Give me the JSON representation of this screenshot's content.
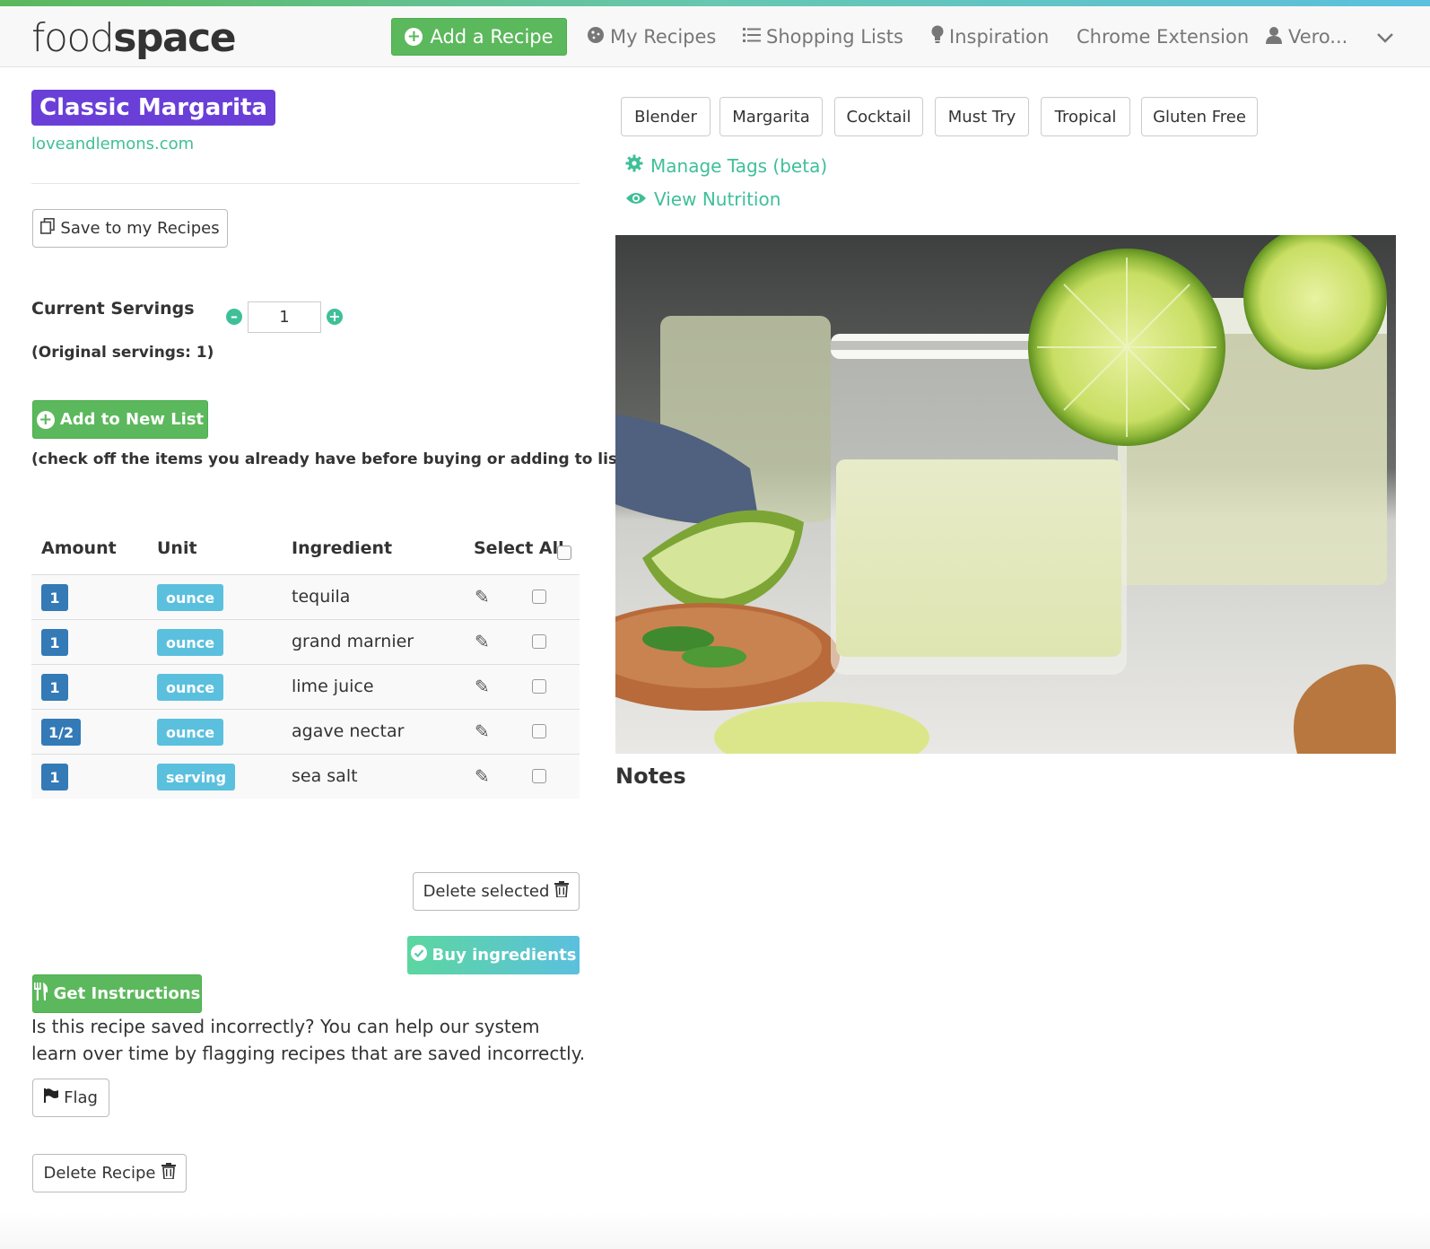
{
  "colors": {
    "brand_green": "#5cb85c",
    "teal": "#3fbf98",
    "title_purple": "#6a3fd8",
    "amount_blue": "#337ab7",
    "unit_cyan": "#5bc0de",
    "buy_gradient_start": "#5cd6a0",
    "buy_gradient_end": "#5bc0de"
  },
  "nav": {
    "logo_light": "food",
    "logo_bold": "space",
    "add_recipe": "Add a Recipe",
    "my_recipes": "My Recipes",
    "shopping_lists": "Shopping Lists",
    "inspiration": "Inspiration",
    "chrome_extension": "Chrome Extension",
    "user": "Vero...",
    "icons": [
      "plus-circle-icon",
      "cookie-icon",
      "list-icon",
      "lightbulb-icon",
      "user-icon",
      "chevron-down-icon"
    ]
  },
  "recipe": {
    "title": "Classic Margarita",
    "source": "loveandlemons.com",
    "save_label": "Save to my Recipes"
  },
  "servings": {
    "label": "Current Servings",
    "value": "1",
    "original": "(Original servings: 1)"
  },
  "list": {
    "add_new": "Add to New List",
    "hint": "(check off the items you already have before buying or adding to list)"
  },
  "table": {
    "headers": {
      "amount": "Amount",
      "unit": "Unit",
      "ingredient": "Ingredient",
      "select_all": "Select All"
    },
    "rows": [
      {
        "amount": "1",
        "unit": "ounce",
        "ingredient": "tequila"
      },
      {
        "amount": "1",
        "unit": "ounce",
        "ingredient": "grand marnier"
      },
      {
        "amount": "1",
        "unit": "ounce",
        "ingredient": "lime juice"
      },
      {
        "amount": "1/2",
        "unit": "ounce",
        "ingredient": "agave nectar"
      },
      {
        "amount": "1",
        "unit": "serving",
        "ingredient": "sea salt"
      }
    ]
  },
  "actions": {
    "delete_selected": "Delete selected",
    "buy_ingredients": "Buy ingredients",
    "get_instructions": "Get Instructions",
    "flag_help": "Is this recipe saved incorrectly? You can help our system learn over time by flagging recipes that are saved incorrectly.",
    "flag": "Flag",
    "delete_recipe": "Delete Recipe"
  },
  "tags": [
    "Blender",
    "Margarita",
    "Cocktail",
    "Must Try",
    "Tropical",
    "Gluten Free"
  ],
  "links": {
    "manage_tags": "Manage Tags (beta)",
    "view_nutrition": "View Nutrition"
  },
  "notes": {
    "heading": "Notes"
  }
}
